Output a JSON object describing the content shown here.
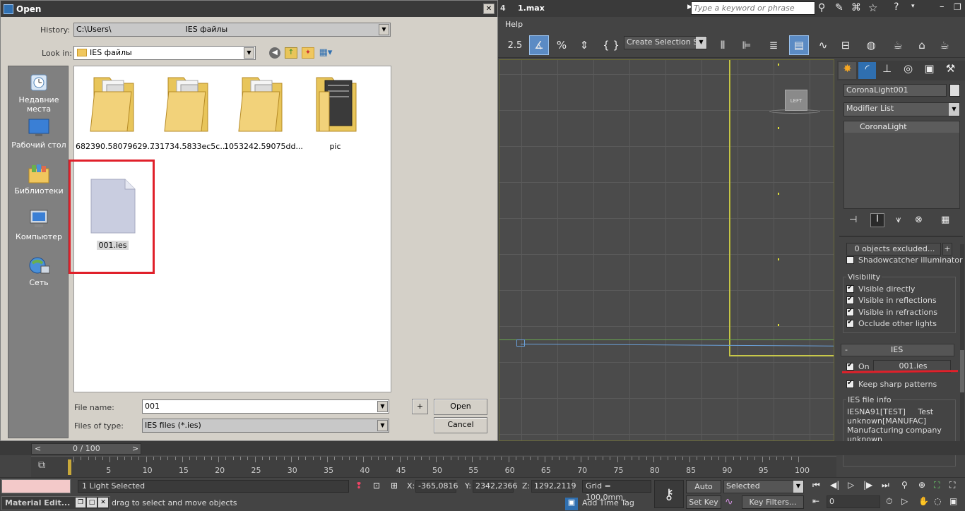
{
  "dialog": {
    "title": "Open",
    "history_label": "History:",
    "history_value": "C:\\Users\\                              IES файлы",
    "lookin_label": "Look in:",
    "lookin_value": "IES файлы",
    "places": [
      {
        "label": "Недавние места",
        "icon": "recent-places-icon"
      },
      {
        "label": "Рабочий стол",
        "icon": "desktop-icon"
      },
      {
        "label": "Библиотеки",
        "icon": "libraries-icon"
      },
      {
        "label": "Компьютер",
        "icon": "computer-icon"
      },
      {
        "label": "Сеть",
        "icon": "network-icon"
      }
    ],
    "files": [
      {
        "name": "682390.58079629...",
        "type": "folder"
      },
      {
        "name": "731734.5833ec5c...",
        "type": "folder"
      },
      {
        "name": "1053242.59075dd...",
        "type": "folder"
      },
      {
        "name": "pic",
        "type": "folder"
      },
      {
        "name": "001.ies",
        "type": "file"
      }
    ],
    "filename_label": "File name:",
    "filename_value": "001",
    "filetype_label": "Files of type:",
    "filetype_value": "IES files (*.ies)",
    "plus_label": "+",
    "open_label": "Open",
    "cancel_label": "Cancel",
    "highlight_color": "#e0202a"
  },
  "max": {
    "tab_number": "4",
    "file_title": "1.max",
    "search_placeholder": "Type a keyword or phrase",
    "menu_help": "Help",
    "snap_value": "2.5",
    "selection_set": "Create Selection Se",
    "viewcube_label": "LEFT"
  },
  "command_panel": {
    "object_name": "CoronaLight001",
    "modifier_list": "Modifier List",
    "stack_item": "CoronaLight",
    "excluded": "0 objects excluded...",
    "excluded_plus": "+",
    "shadowcatcher": "Shadowcatcher illuminator",
    "visibility_label": "Visibility",
    "visibility": [
      {
        "label": "Visible directly",
        "checked": true
      },
      {
        "label": "Visible in reflections",
        "checked": true
      },
      {
        "label": "Visible in refractions",
        "checked": true
      },
      {
        "label": "Occlude other lights",
        "checked": true
      }
    ],
    "ies_rollout_minus": "-",
    "ies_rollout_title": "IES",
    "ies_on_label": "On",
    "ies_file": "001.ies",
    "keep_sharp": "Keep sharp patterns",
    "ies_info_label": "IES file info",
    "ies_info_lines": [
      "IESNA91[TEST]     Test",
      "unknown[MANUFAC]",
      "Manufacturing company",
      "unknown"
    ]
  },
  "timeline": {
    "frame_counter": "0 / 100",
    "prev": "<",
    "next": ">",
    "ticks": [
      "5",
      "10",
      "15",
      "20",
      "25",
      "30",
      "35",
      "40",
      "45",
      "50",
      "55",
      "60",
      "65",
      "70",
      "75",
      "80",
      "85",
      "90",
      "95",
      "100"
    ]
  },
  "status": {
    "selection": "1 Light Selected",
    "prompt": "drag to select and move objects",
    "x_label": "X:",
    "x_value": "-365,0816",
    "y_label": "Y:",
    "y_value": "2342,2366",
    "z_label": "Z:",
    "z_value": "1292,2119",
    "grid": "Grid = 100,0mm",
    "add_time_tag": "Add Time Tag",
    "auto_key": "Auto Key",
    "set_key": "Set Key",
    "selected": "Selected",
    "key_filters": "Key Filters...",
    "frame_field": "0",
    "material_editor": "Material Edit..."
  }
}
